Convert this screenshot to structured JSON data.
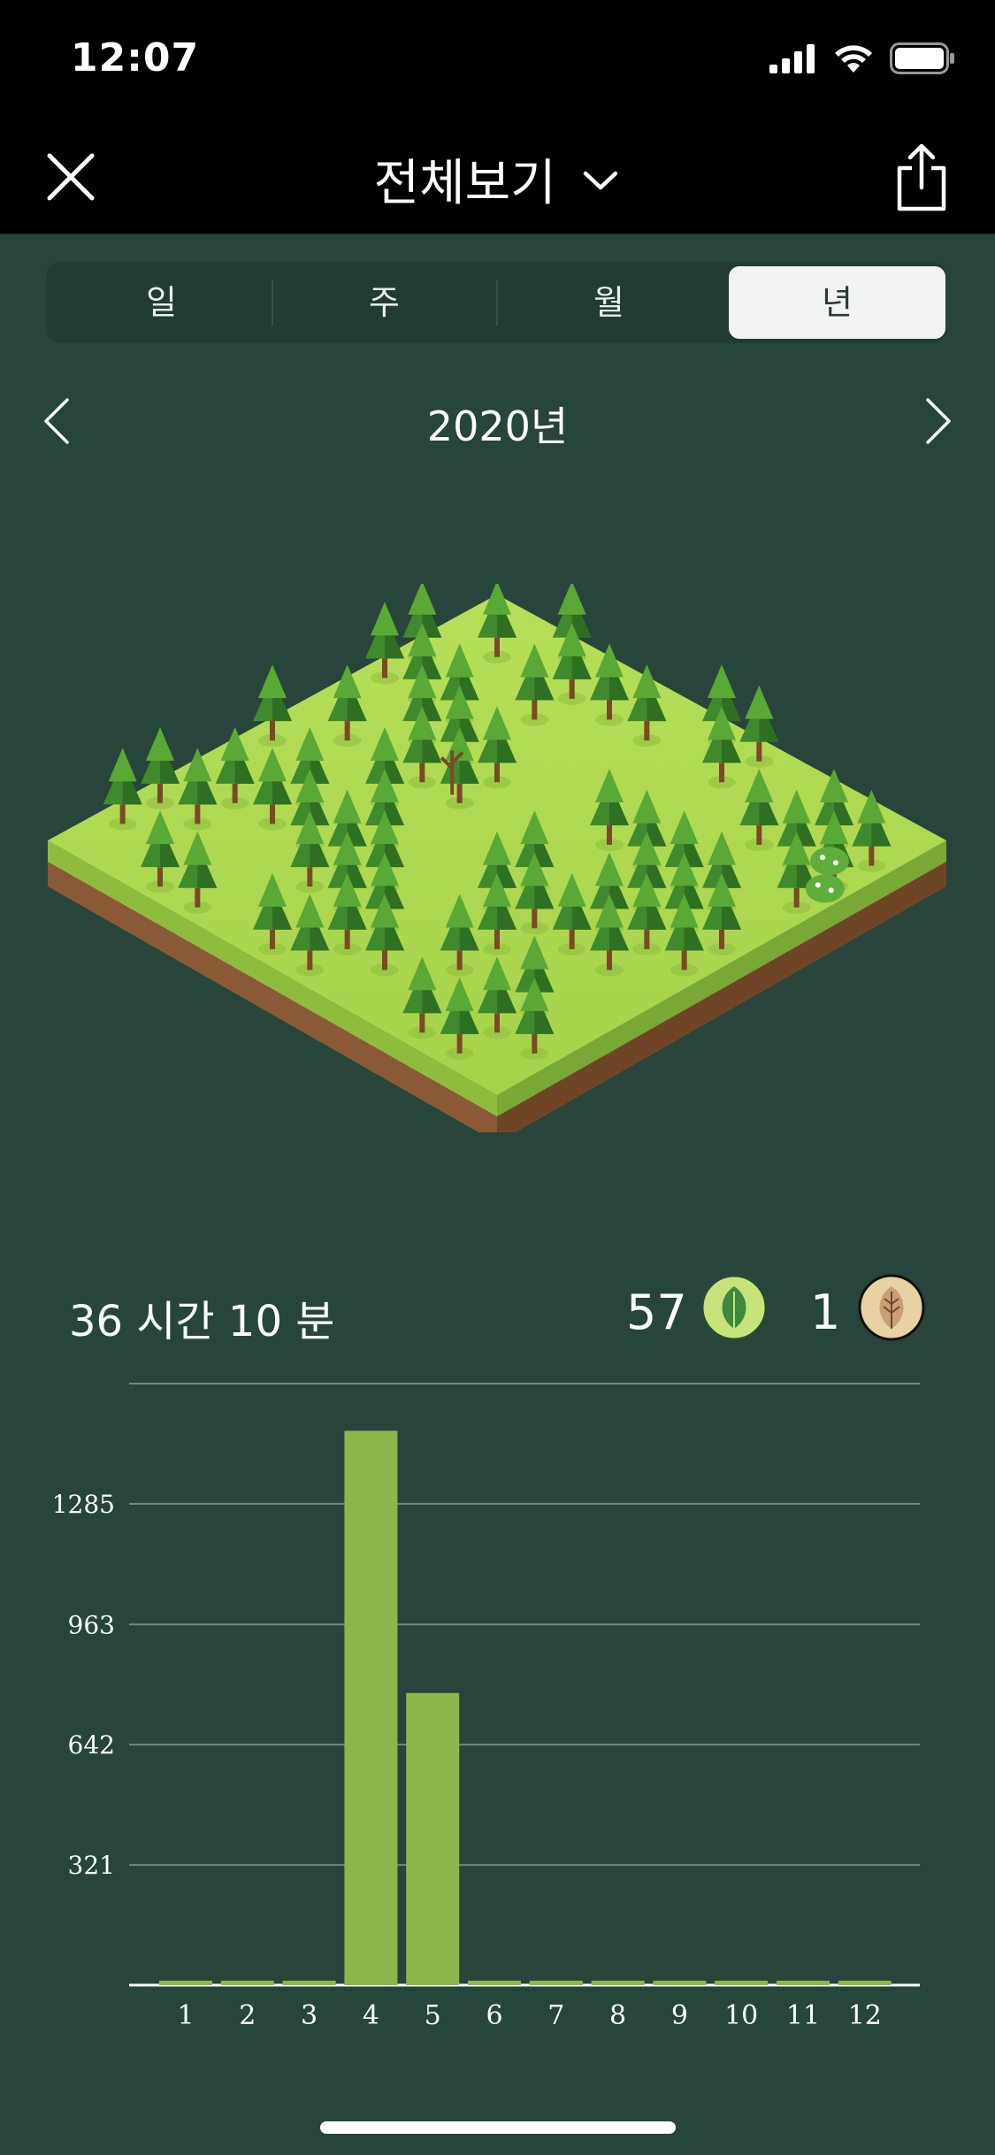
{
  "status": {
    "time": "12:07"
  },
  "nav": {
    "title": "전체보기"
  },
  "segments": [
    "일",
    "주",
    "월",
    "년"
  ],
  "active_segment": "년",
  "period": {
    "label": "2020년"
  },
  "summary": {
    "total_time": "36 시간 10 분",
    "healthy_count": "57",
    "withered_count": "1"
  },
  "colors": {
    "background": "#27453a",
    "bar": "#8ab84a",
    "healthy_badge": "#c7e37a",
    "withered_badge": "#e8d2a3"
  },
  "chart_data": {
    "type": "bar",
    "categories": [
      "1",
      "2",
      "3",
      "4",
      "5",
      "6",
      "7",
      "8",
      "9",
      "10",
      "11",
      "12"
    ],
    "values": [
      12,
      12,
      12,
      1480,
      780,
      12,
      12,
      12,
      12,
      12,
      12,
      12
    ],
    "yticks": [
      321,
      642,
      963,
      1285
    ],
    "ylim": [
      0,
      1606
    ],
    "grid": true,
    "title": "",
    "xlabel": "",
    "ylabel": ""
  }
}
